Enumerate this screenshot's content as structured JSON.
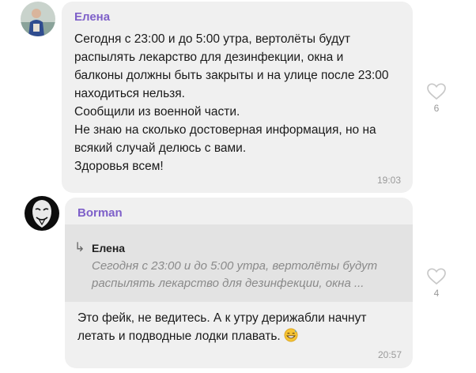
{
  "messages": [
    {
      "sender": "Елена",
      "text": "Сегодня  с 23:00 и до 5:00 утра, вертолёты будут\nраспылять лекарство для дезинфекции, окна и\nбалконы должны быть закрыты и на улице после 23:00\nнаходиться нельзя.\nСообщили из военной части.\nНе знаю на сколько достоверная информация, но на\nвсякий случай делюсь с вами.\nЗдоровья всем!",
      "time": "19:03",
      "likes": "6"
    },
    {
      "sender": "Borman",
      "reply": {
        "author": "Елена",
        "text": "Сегодня  с 23:00 и до 5:00 утра, вертолёты будут\nраспылять лекарство для дезинфекции, окна ..."
      },
      "text": "Это фейк, не ведитесь. А к утру дерижабли начнут\nлетать и подводные лодки плавать.",
      "emoji": "grinning-sweat-emoji",
      "time": "20:57",
      "likes": "4"
    }
  ],
  "icons": {
    "like": "heart-outline-icon",
    "reply": "reply-arrow-icon"
  },
  "colors": {
    "sender_name": "#7e60c9",
    "bubble_bg": "#f0f0f0",
    "reply_bg": "#e3e3e3",
    "timestamp": "#9a9a9a"
  }
}
